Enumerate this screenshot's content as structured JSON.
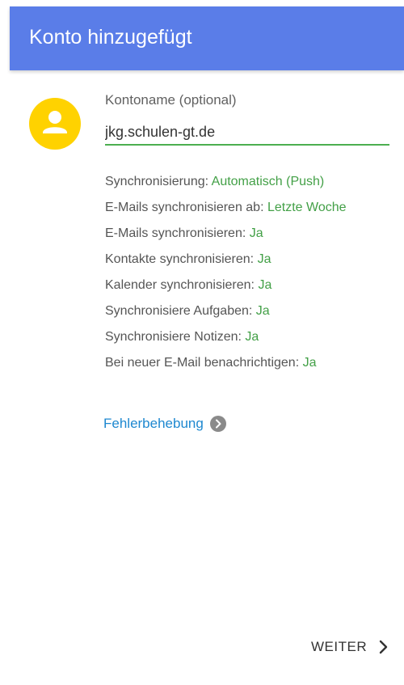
{
  "header": {
    "title": "Konto hinzugefügt",
    "accent_color": "#5a7de8"
  },
  "account": {
    "avatar_icon": "person-icon",
    "avatar_color": "#ffd200",
    "name_label": "Kontoname (optional)",
    "name_value": "jkg.schulen-gt.de"
  },
  "settings": [
    {
      "label": "Synchronisierung:",
      "value": "Automatisch (Push)"
    },
    {
      "label": "E-Mails synchronisieren ab:",
      "value": "Letzte Woche"
    },
    {
      "label": "E-Mails synchronisieren:",
      "value": "Ja"
    },
    {
      "label": "Kontakte synchronisieren:",
      "value": "Ja"
    },
    {
      "label": "Kalender synchronisieren:",
      "value": "Ja"
    },
    {
      "label": "Synchronisiere Aufgaben:",
      "value": "Ja"
    },
    {
      "label": "Synchronisiere Notizen:",
      "value": "Ja"
    },
    {
      "label": "Bei neuer E-Mail benachrichtigen:",
      "value": "Ja"
    }
  ],
  "troubleshoot": {
    "label": "Fehlerbehebung",
    "icon": "chevron-right-circle-icon"
  },
  "footer": {
    "next_label": "WEITER",
    "next_icon": "chevron-right-icon"
  },
  "colors": {
    "value_green": "#43a047",
    "link_blue": "#1e88d0",
    "underline_green": "#4caf50"
  }
}
